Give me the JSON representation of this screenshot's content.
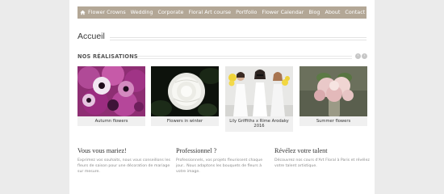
{
  "nav": {
    "home_icon": "home-icon",
    "items": [
      "Flower Crowns",
      "Wedding",
      "Corporate",
      "Floral Art course",
      "Portfolio",
      "Flower Calendar",
      "Blog",
      "About",
      "Contact"
    ]
  },
  "page": {
    "title": "Accueil"
  },
  "realisations": {
    "title": "NOS RÉALISATIONS",
    "cards": [
      {
        "caption": "Autumn flowers"
      },
      {
        "caption": "Flowers in winter"
      },
      {
        "caption": "Lily Griffiths x Rime Arodaky 2016"
      },
      {
        "caption": "Summer flowers"
      }
    ]
  },
  "columns": [
    {
      "heading": "Vous vous mariez!",
      "text": "Exprimez vos souhaits, nous vous conseillons les fleurs de saison pour une décoration de mariage sur mesure."
    },
    {
      "heading": "Professionnel ?",
      "text": "Professionnels, vos projets fleurissent chaque jour.. Nous adaptons les bouquets de fleurs à votre image."
    },
    {
      "heading": "Révélez votre talent",
      "text": "Découvrez nos cours d'Art Floral à Paris et révélez votre talent artistique."
    }
  ],
  "colors": {
    "nav_bg": "#b3a796",
    "page_bg": "#ebebeb"
  }
}
